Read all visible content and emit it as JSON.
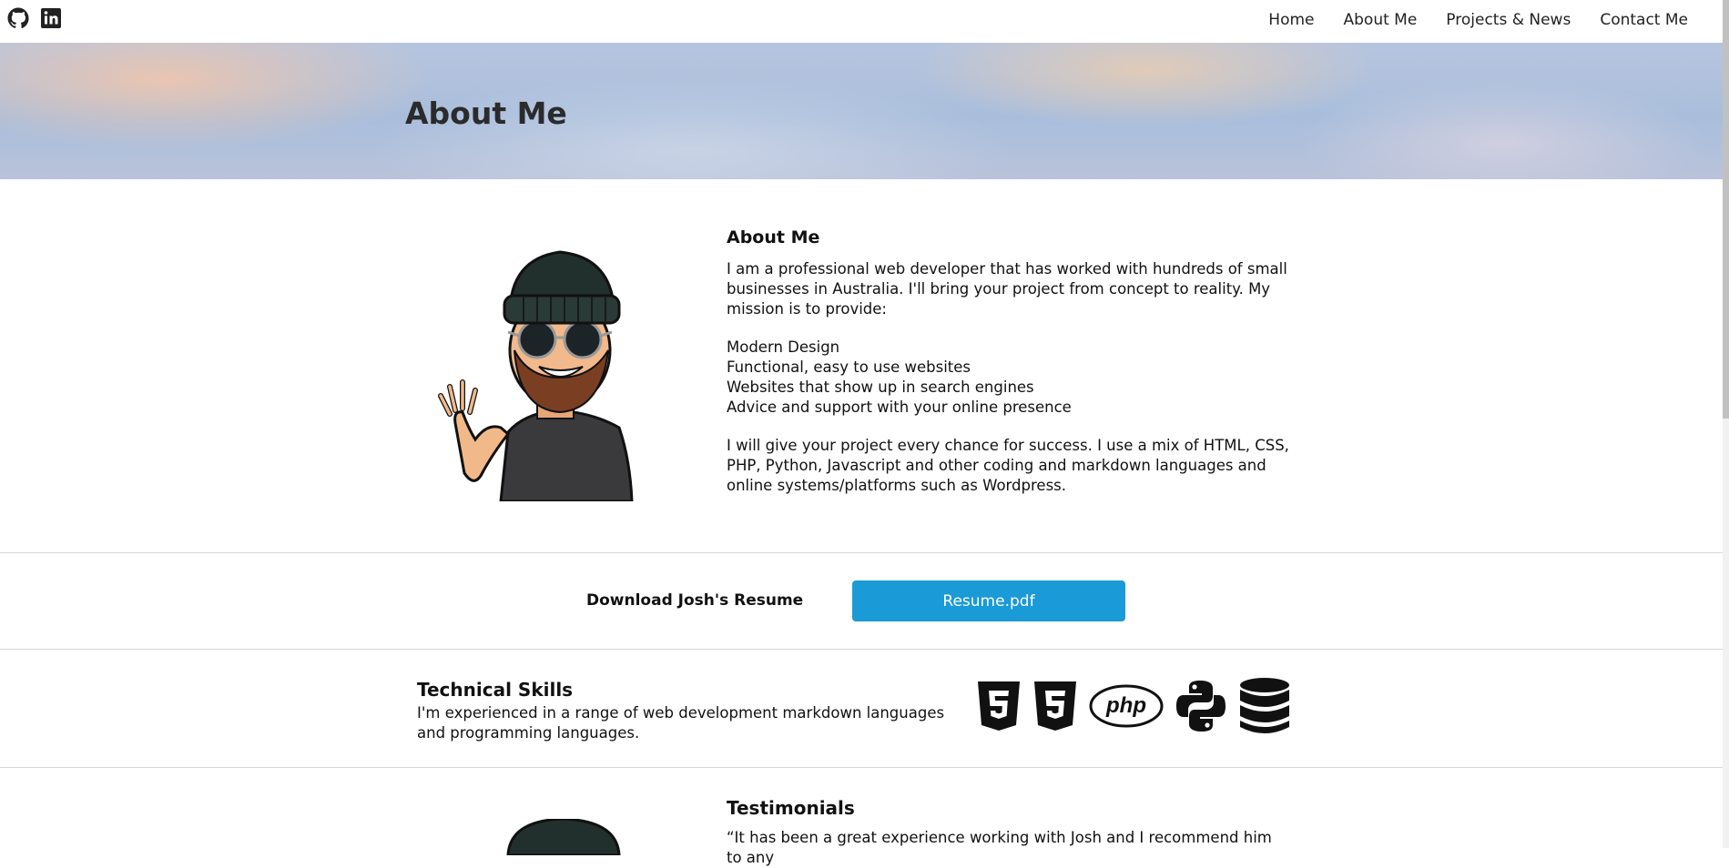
{
  "nav": {
    "social": [
      {
        "icon": "github-icon"
      },
      {
        "icon": "linkedin-icon"
      }
    ],
    "links": [
      "Home",
      "About Me",
      "Projects & News",
      "Contact Me"
    ]
  },
  "hero": {
    "title": "About Me"
  },
  "about": {
    "heading": "About Me",
    "intro": "I am a professional web developer that has worked with hundreds of small businesses in Australia. I'll bring your project from concept to reality. My mission is to provide:",
    "list": [
      "Modern Design",
      "Functional, easy to use websites",
      "Websites that show up in search engines",
      "Advice and support with your online presence"
    ],
    "outro": "I will give your project every chance for success. I use a mix of HTML, CSS, PHP, Python, Javascript and other coding and markdown languages and online systems/platforms such as Wordpress."
  },
  "resume": {
    "label": "Download Josh's Resume",
    "button": "Resume.pdf",
    "button_color": "#1a9ad6"
  },
  "skills": {
    "heading": "Technical Skills",
    "text": "I'm experienced in a range of web development markdown languages and programming languages.",
    "icons": [
      "html5-icon",
      "css3-icon",
      "php-icon",
      "python-icon",
      "database-icon"
    ]
  },
  "testimonials": {
    "heading": "Testimonials",
    "quote": "“It has been a great experience working with Josh and I recommend him to any"
  }
}
